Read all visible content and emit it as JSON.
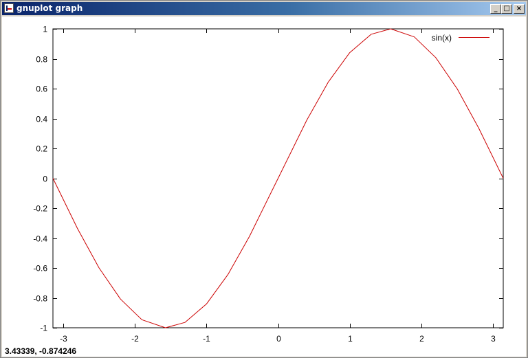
{
  "window": {
    "title": "gnuplot graph",
    "buttons": {
      "minimize": "_",
      "maximize": "□",
      "close": "×"
    }
  },
  "status": {
    "coords": "3.43339, -0.874246"
  },
  "colors": {
    "series": "#cc0000",
    "axes": "#000000",
    "background": "#ffffff"
  },
  "chart_data": {
    "type": "line",
    "title": "",
    "xlabel": "",
    "ylabel": "",
    "xlim": [
      -3.14159,
      3.14159
    ],
    "ylim": [
      -1,
      1
    ],
    "grid": false,
    "legend_position": "top-right",
    "xticks": [
      -3,
      -2,
      -1,
      0,
      1,
      2,
      3
    ],
    "yticks": [
      -1,
      -0.8,
      -0.6,
      -0.4,
      -0.2,
      0,
      0.2,
      0.4,
      0.6,
      0.8,
      1
    ],
    "xtick_labels": [
      "-3",
      "-2",
      "-1",
      "0",
      "1",
      "2",
      "3"
    ],
    "ytick_labels": [
      "-1",
      "-0.8",
      "-0.6",
      "-0.4",
      "-0.2",
      "0",
      "0.2",
      "0.4",
      "0.6",
      "0.8",
      "1"
    ],
    "series": [
      {
        "name": "sin(x)",
        "color": "#cc0000",
        "x": [
          -3.14159,
          -2.8,
          -2.5,
          -2.2,
          -1.9,
          -1.5708,
          -1.3,
          -1.0,
          -0.7,
          -0.4,
          0,
          0.4,
          0.7,
          1.0,
          1.3,
          1.5708,
          1.9,
          2.2,
          2.5,
          2.8,
          3.14159
        ],
        "y": [
          0,
          -0.335,
          -0.598,
          -0.808,
          -0.946,
          -1,
          -0.964,
          -0.841,
          -0.644,
          -0.389,
          0,
          0.389,
          0.644,
          0.841,
          0.964,
          1,
          0.946,
          0.808,
          0.598,
          0.335,
          0
        ]
      }
    ]
  }
}
